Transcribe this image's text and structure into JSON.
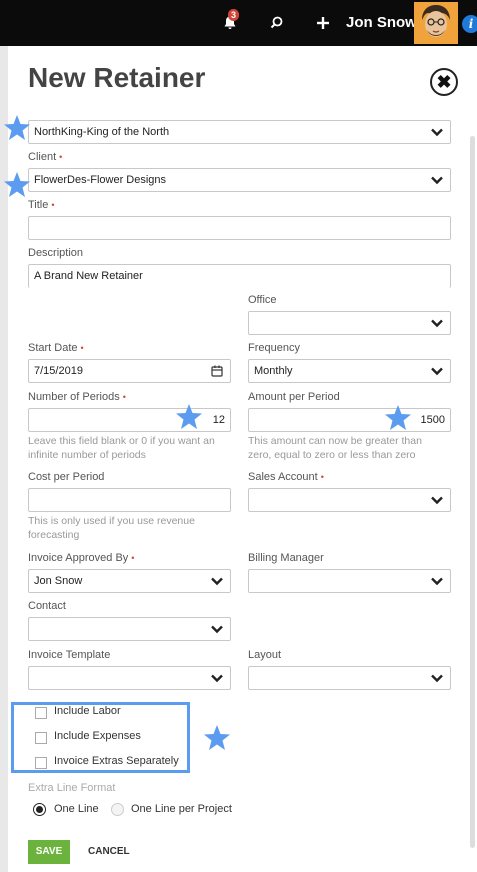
{
  "topbar": {
    "notification_count": "3",
    "user_name": "Jon Snow",
    "icons": [
      "bell-icon",
      "search-icon",
      "plus-icon",
      "avatar",
      "info-icon"
    ],
    "info_glyph": "i"
  },
  "page": {
    "title": "New Retainer",
    "close_glyph": "✖"
  },
  "form": {
    "company": {
      "value": "NorthKing-King of the North"
    },
    "client": {
      "label": "Client",
      "value": "FlowerDes-Flower Designs"
    },
    "title_field": {
      "label": "Title",
      "value": ""
    },
    "description": {
      "label": "Description",
      "value": "A Brand New Retainer"
    },
    "office": {
      "label": "Office",
      "value": ""
    },
    "start_date": {
      "label": "Start Date",
      "value": "7/15/2019"
    },
    "frequency": {
      "label": "Frequency",
      "value": "Monthly"
    },
    "number_of_periods": {
      "label": "Number of Periods",
      "value": "12",
      "help_1": "Leave this field blank or 0 if you want an",
      "help_2": "infinite number of periods"
    },
    "amount_per_period": {
      "label": "Amount per Period",
      "value": "1500",
      "help_1": "This amount can now be greater than",
      "help_2": "zero, equal to zero or less than zero"
    },
    "cost_per_period": {
      "label": "Cost per Period",
      "value": "",
      "help_1": "This is only used if you use revenue",
      "help_2": "forecasting"
    },
    "sales_account": {
      "label": "Sales Account",
      "value": ""
    },
    "invoice_approved_by": {
      "label": "Invoice Approved By",
      "value": "Jon Snow"
    },
    "billing_manager": {
      "label": "Billing Manager",
      "value": ""
    },
    "contact": {
      "label": "Contact",
      "value": ""
    },
    "invoice_template": {
      "label": "Invoice Template",
      "value": ""
    },
    "layout": {
      "label": "Layout",
      "value": ""
    },
    "checkboxes": [
      {
        "label": "Include Labor",
        "checked": false
      },
      {
        "label": "Include Expenses",
        "checked": false
      },
      {
        "label": "Invoice Extras Separately",
        "checked": false
      }
    ],
    "extra_line_format": {
      "label": "Extra Line Format",
      "options": [
        {
          "label": "One Line",
          "selected": true
        },
        {
          "label": "One Line per Project",
          "selected": false
        }
      ]
    },
    "required_mark": "•"
  },
  "actions": {
    "save_label": "SAVE",
    "cancel_label": "CANCEL"
  },
  "colors": {
    "accent_green": "#6bb33c",
    "required_red": "#d0443a",
    "annotation_blue": "#5b9cf0",
    "topbar_bg": "#0b0b0b"
  }
}
